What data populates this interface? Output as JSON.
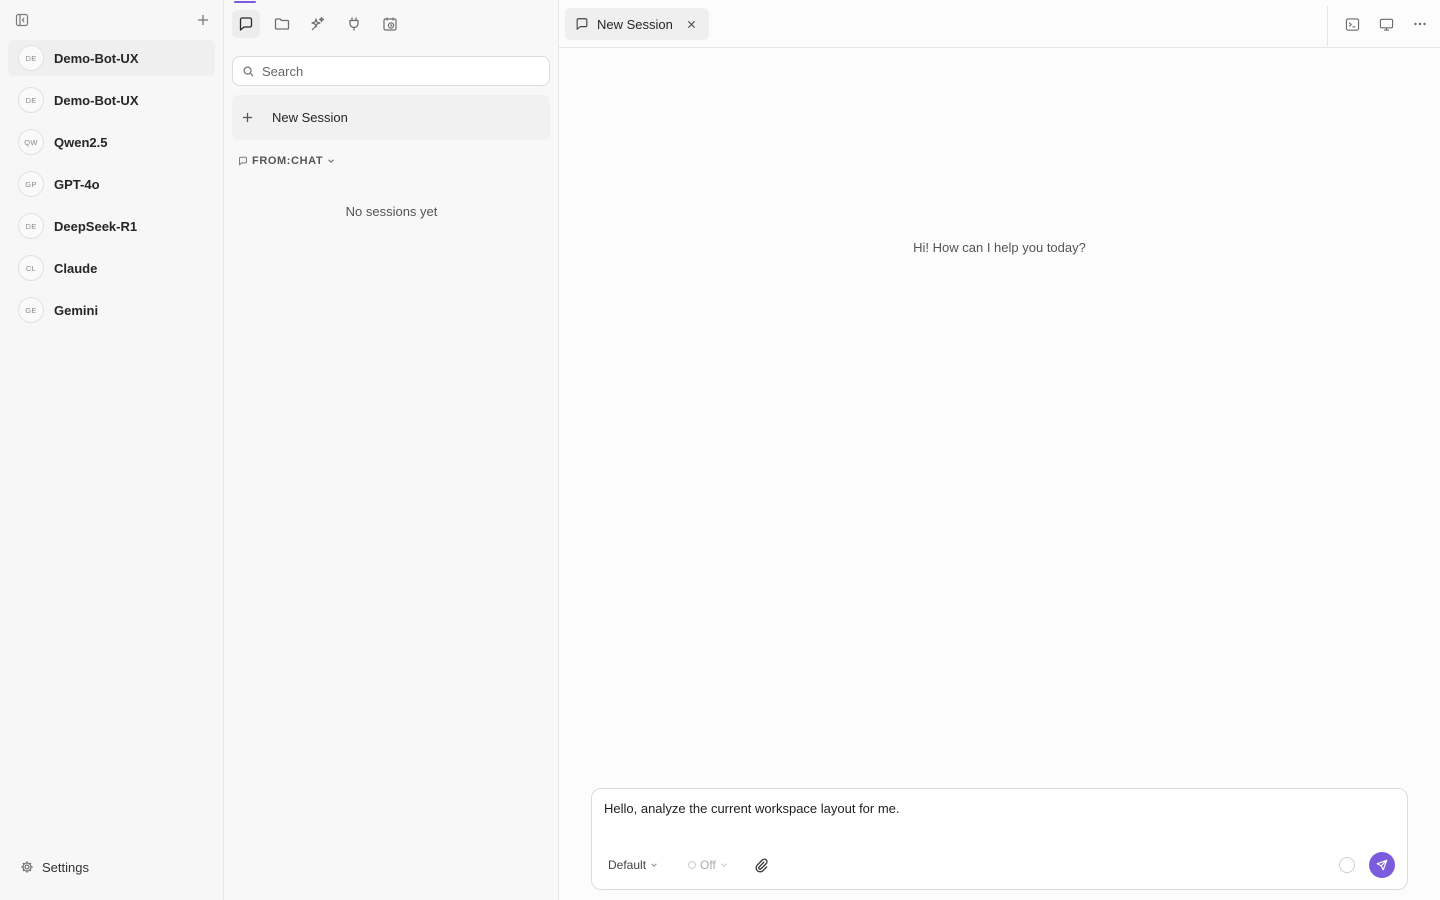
{
  "sidebar": {
    "agents": [
      {
        "initials": "DE",
        "name": "Demo-Bot-UX"
      },
      {
        "initials": "DE",
        "name": "Demo-Bot-UX"
      },
      {
        "initials": "QW",
        "name": "Qwen2.5"
      },
      {
        "initials": "GP",
        "name": "GPT-4o"
      },
      {
        "initials": "DE",
        "name": "DeepSeek-R1"
      },
      {
        "initials": "CL",
        "name": "Claude"
      },
      {
        "initials": "GE",
        "name": "Gemini"
      }
    ],
    "settings_label": "Settings"
  },
  "sessions": {
    "search_placeholder": "Search",
    "new_session_label": "New Session",
    "filter_label": "FROM:CHAT",
    "empty_text": "No sessions yet"
  },
  "main": {
    "tab_label": "New Session",
    "greeting": "Hi! How can I help you today?",
    "composer": {
      "text": "Hello, analyze the current workspace layout for me.",
      "mode_label": "Default",
      "toggle_label": "Off"
    }
  },
  "colors": {
    "accent": "#7c5cdd"
  }
}
